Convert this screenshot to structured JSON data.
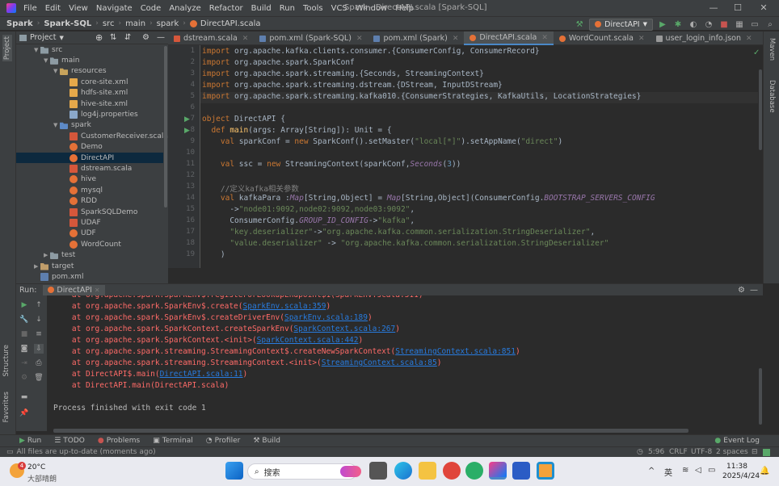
{
  "titlebar": {
    "menus": [
      "File",
      "Edit",
      "View",
      "Navigate",
      "Code",
      "Analyze",
      "Refactor",
      "Build",
      "Run",
      "Tools",
      "VCS",
      "Window",
      "Help"
    ],
    "title": "Spark - DirectAPI.scala [Spark-SQL]"
  },
  "breadcrumb": [
    "Spark",
    "Spark-SQL",
    "src",
    "main",
    "spark",
    "DirectAPI.scala"
  ],
  "run_config": "DirectAPI",
  "project_panel": {
    "title": "Project",
    "tree": [
      {
        "label": "src",
        "depth": 0,
        "type": "folder",
        "expanded": true
      },
      {
        "label": "main",
        "depth": 1,
        "type": "folder",
        "expanded": true
      },
      {
        "label": "resources",
        "depth": 2,
        "type": "resources",
        "expanded": true
      },
      {
        "label": "core-site.xml",
        "depth": 3,
        "type": "xml"
      },
      {
        "label": "hdfs-site.xml",
        "depth": 3,
        "type": "xml"
      },
      {
        "label": "hive-site.xml",
        "depth": 3,
        "type": "xml"
      },
      {
        "label": "log4j.properties",
        "depth": 3,
        "type": "props"
      },
      {
        "label": "spark",
        "depth": 2,
        "type": "source",
        "expanded": true
      },
      {
        "label": "CustomerReceiver.scala",
        "depth": 3,
        "type": "scala-file"
      },
      {
        "label": "Demo",
        "depth": 3,
        "type": "scala-obj"
      },
      {
        "label": "DirectAPI",
        "depth": 3,
        "type": "scala-obj"
      },
      {
        "label": "dstream.scala",
        "depth": 3,
        "type": "scala-file"
      },
      {
        "label": "hive",
        "depth": 3,
        "type": "scala-obj"
      },
      {
        "label": "mysql",
        "depth": 3,
        "type": "scala-obj"
      },
      {
        "label": "RDD",
        "depth": 3,
        "type": "scala-obj"
      },
      {
        "label": "SparkSQLDemo",
        "depth": 3,
        "type": "scala-file"
      },
      {
        "label": "UDAF",
        "depth": 3,
        "type": "scala-file"
      },
      {
        "label": "UDF",
        "depth": 3,
        "type": "scala-obj"
      },
      {
        "label": "WordCount",
        "depth": 3,
        "type": "scala-obj"
      },
      {
        "label": "test",
        "depth": 1,
        "type": "folder",
        "expanded": false
      },
      {
        "label": "target",
        "depth": 0,
        "type": "target",
        "expanded": false
      },
      {
        "label": "pom.xml",
        "depth": 0,
        "type": "pom"
      }
    ]
  },
  "editor_tabs": [
    {
      "label": "dstream.scala",
      "active": false
    },
    {
      "label": "pom.xml (Spark-SQL)",
      "active": false
    },
    {
      "label": "pom.xml (Spark)",
      "active": false
    },
    {
      "label": "DirectAPI.scala",
      "active": true
    },
    {
      "label": "WordCount.scala",
      "active": false
    },
    {
      "label": "user_login_info.json",
      "active": false
    }
  ],
  "line_numbers": [
    "1",
    "2",
    "3",
    "4",
    "5",
    "6",
    "7",
    "8",
    "9",
    "10",
    "11",
    "12",
    "13",
    "14",
    "15",
    "16",
    "17",
    "18",
    "19"
  ],
  "code_lines": [
    [
      [
        "kw",
        "import "
      ],
      [
        "ty",
        "org.apache.kafka.clients.consumer.{ConsumerConfig, ConsumerRecord}"
      ]
    ],
    [
      [
        "kw",
        "import "
      ],
      [
        "ty",
        "org.apache.spark.SparkConf"
      ]
    ],
    [
      [
        "kw",
        "import "
      ],
      [
        "ty",
        "org.apache.spark.streaming.{Seconds, StreamingContext}"
      ]
    ],
    [
      [
        "kw",
        "import "
      ],
      [
        "ty",
        "org.apache.spark.streaming.dstream.{DStream, InputDStream}"
      ]
    ],
    [
      [
        "kw",
        "import "
      ],
      [
        "ty",
        "org.apache.spark.streaming.kafka010.{ConsumerStrategies, KafkaUtils, LocationStrategies}"
      ]
    ],
    [
      [
        "ty",
        ""
      ]
    ],
    [
      [
        "kw",
        "object "
      ],
      [
        "ty",
        "DirectAPI {"
      ]
    ],
    [
      [
        "kw",
        "  def "
      ],
      [
        "fn",
        "main"
      ],
      [
        "ty",
        "(args: Array["
      ],
      [
        "ty",
        "String"
      ],
      [
        "ty",
        "]): "
      ],
      [
        "ty",
        "Unit"
      ],
      [
        "ty",
        " = {"
      ]
    ],
    [
      [
        "kw",
        "    val "
      ],
      [
        "ty",
        "sparkConf = "
      ],
      [
        "kw",
        "new "
      ],
      [
        "ty",
        "SparkConf().setMaster("
      ],
      [
        "str",
        "\"local[*]\""
      ],
      [
        "ty",
        ").setAppName("
      ],
      [
        "str",
        "\"direct\""
      ],
      [
        "ty",
        ")"
      ]
    ],
    [
      [
        "ty",
        ""
      ]
    ],
    [
      [
        "kw",
        "    val "
      ],
      [
        "ty",
        "ssc = "
      ],
      [
        "kw",
        "new "
      ],
      [
        "ty",
        "StreamingContext(sparkConf,"
      ],
      [
        "it",
        "Seconds"
      ],
      [
        "ty",
        "("
      ],
      [
        "num",
        "3"
      ],
      [
        "ty",
        "))"
      ]
    ],
    [
      [
        "ty",
        ""
      ]
    ],
    [
      [
        "cm",
        "    //定义kafka相关参数"
      ]
    ],
    [
      [
        "kw",
        "    val "
      ],
      [
        "ty",
        "kafkaPara :"
      ],
      [
        "it",
        "Map"
      ],
      [
        "ty",
        "[String,Object] = "
      ],
      [
        "it",
        "Map"
      ],
      [
        "ty",
        "[String,Object](ConsumerConfig."
      ],
      [
        "it",
        "BOOTSTRAP_SERVERS_CONFIG"
      ]
    ],
    [
      [
        "ty",
        "      ->"
      ],
      [
        "str",
        "\"node01:9092,node02:9092,node03:9092\""
      ],
      [
        "ty",
        ","
      ]
    ],
    [
      [
        "ty",
        "      ConsumerConfig."
      ],
      [
        "it",
        "GROUP_ID_CONFIG"
      ],
      [
        "ty",
        "->"
      ],
      [
        "str",
        "\"kafka\""
      ],
      [
        "ty",
        ","
      ]
    ],
    [
      [
        "str",
        "      \"key.deserializer\""
      ],
      [
        "ty",
        "->"
      ],
      [
        "str",
        "\"org.apache.kafka.common.serialization.StringDeserializer\""
      ],
      [
        "ty",
        ","
      ]
    ],
    [
      [
        "str",
        "      \"value.deserializer\""
      ],
      [
        "ty",
        " -> "
      ],
      [
        "str",
        "\"org.apache.kafka.common.serialization.StringDeserializer\""
      ]
    ],
    [
      [
        "ty",
        "    )"
      ]
    ]
  ],
  "run_panel": {
    "label": "Run:",
    "tab": "DirectAPI",
    "lines": [
      {
        "text": "    at org.apache.spark.SparkEnv$.registerOrLookupEndpoint$1(SparkEnv.scala:311)",
        "link": ""
      },
      {
        "text": "    at org.apache.spark.SparkEnv$.create(",
        "link": "SparkEnv.scala:359",
        "tail": ")"
      },
      {
        "text": "    at org.apache.spark.SparkEnv$.createDriverEnv(",
        "link": "SparkEnv.scala:189",
        "tail": ")"
      },
      {
        "text": "    at org.apache.spark.SparkContext.createSparkEnv(",
        "link": "SparkContext.scala:267",
        "tail": ")"
      },
      {
        "text": "    at org.apache.spark.SparkContext.<init>(",
        "link": "SparkContext.scala:442",
        "tail": ")"
      },
      {
        "text": "    at org.apache.spark.streaming.StreamingContext$.createNewSparkContext(",
        "link": "StreamingContext.scala:851",
        "tail": ")"
      },
      {
        "text": "    at org.apache.spark.streaming.StreamingContext.<init>(",
        "link": "StreamingContext.scala:85",
        "tail": ")"
      },
      {
        "text": "    at DirectAPI$.main(",
        "link": "DirectAPI.scala:11",
        "tail": ")"
      },
      {
        "text": "    at DirectAPI.main(DirectAPI.scala)",
        "link": ""
      },
      {
        "text": "",
        "link": ""
      },
      {
        "text": "Process finished with exit code 1",
        "link": "",
        "ok": true
      }
    ]
  },
  "bottom_tabs": [
    "Run",
    "TODO",
    "Problems",
    "Terminal",
    "Profiler",
    "Build"
  ],
  "event_log": "Event Log",
  "status": {
    "message": "All files are up-to-date (moments ago)",
    "position": "5:96",
    "line_sep": "CRLF",
    "encoding": "UTF-8",
    "indent": "2 spaces"
  },
  "side_tabs": {
    "left": [
      "Project",
      "Structure",
      "Favorites"
    ],
    "right": [
      "Maven",
      "Database"
    ]
  },
  "taskbar": {
    "weather_temp": "20°C",
    "weather_desc": "大部晴朗",
    "badge": "4",
    "search": "搜索",
    "ime": "英",
    "time": "11:38",
    "date": "2025/4/24"
  }
}
